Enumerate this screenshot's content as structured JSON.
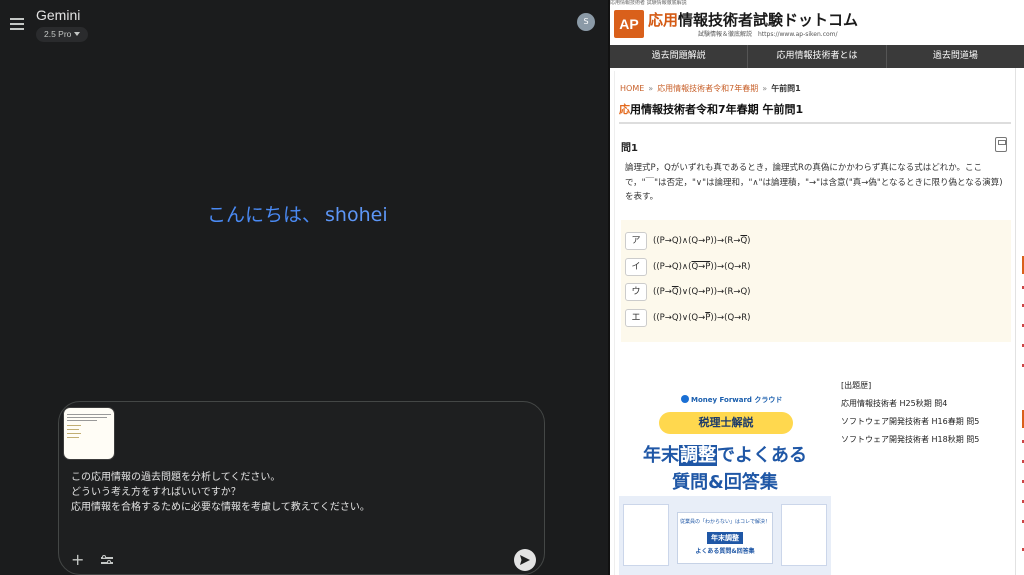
{
  "gemini": {
    "app_title": "Gemini",
    "model": "2.5 Pro",
    "avatar_initial": "S",
    "greeting_prefix": "こんにちは、",
    "greeting_name": "shohei",
    "prompt_lines": [
      "この応用情報の過去問題を分析してください。",
      "どういう考え方をすればいいですか？",
      "応用情報を合格するために必要な情報を考慮して教えてください。"
    ],
    "plus_icon": "+"
  },
  "site": {
    "top_strip": "応用情報技術者 試験情報徹底解説",
    "logo": "AP",
    "name_accent": "応用",
    "name_rest": "情報技術者試験ドットコム",
    "subtitle": "試験情報＆徹底解説　https://www.ap-siken.com/",
    "nav": [
      "過去問題解説",
      "応用情報技術者とは",
      "過去問道場"
    ],
    "breadcrumb": {
      "home": "HOME",
      "sep": "»",
      "middle": "応用情報技術者令和7年春期",
      "current": "午前問1"
    },
    "title_first": "応",
    "title_rest": "用情報技術者令和7年春期 午前問1",
    "question_label": "問1",
    "question_text": "論理式P，Qがいずれも真であるとき，論理式Rの真偽にかかわらず真になる式はどれか。ここで，\"￣\"は否定，\"∨\"は論理和，\"∧\"は論理積，\"→\"は含意(\"真→偽\"となるときに限り偽となる演算)を表す。",
    "choices": [
      {
        "label": "ア",
        "pre": "((P→Q)∧(Q→P))→(R→",
        "bar": "Q",
        "post": ")"
      },
      {
        "label": "イ",
        "pre": "((P→Q)∧(",
        "bar": "Q→P",
        "post": "))→(Q→R)"
      },
      {
        "label": "ウ",
        "pre": "((P→",
        "bar": "Q",
        "post": ")∨(Q→P))→(R→Q)"
      },
      {
        "label": "エ",
        "pre": "((P→Q)∨(Q→",
        "bar": "P",
        "post": "))→(Q→R)"
      }
    ],
    "ad": {
      "brand": "Money Forward クラウド",
      "badge": "税理士解説",
      "line1_pre": "年末",
      "line1_hl": "調整",
      "line1_post": "でよくある",
      "line2": "質問&回答集",
      "mini_line1": "従業員の「わからない」はコレで解決！",
      "mini_line2": "年末調整",
      "mini_line3": "よくある質問&回答集"
    },
    "history_label": "[出題歴]",
    "history": [
      "応用情報技術者 H25秋期 問4",
      "ソフトウェア開発技術者 H16春期 問5",
      "ソフトウェア開発技術者 H18秋期 問5"
    ]
  },
  "colors": {
    "gemini_bg": "#1b1c1d",
    "greeting_blue": "#4a8af4",
    "site_accent": "#d9601b",
    "nav_bg": "#3a3a3a",
    "choices_bg": "#fdf9ec"
  },
  "icons": [
    "menu-icon",
    "caret-down-icon",
    "plus-icon",
    "tools-icon",
    "send-icon",
    "calculator-icon"
  ]
}
